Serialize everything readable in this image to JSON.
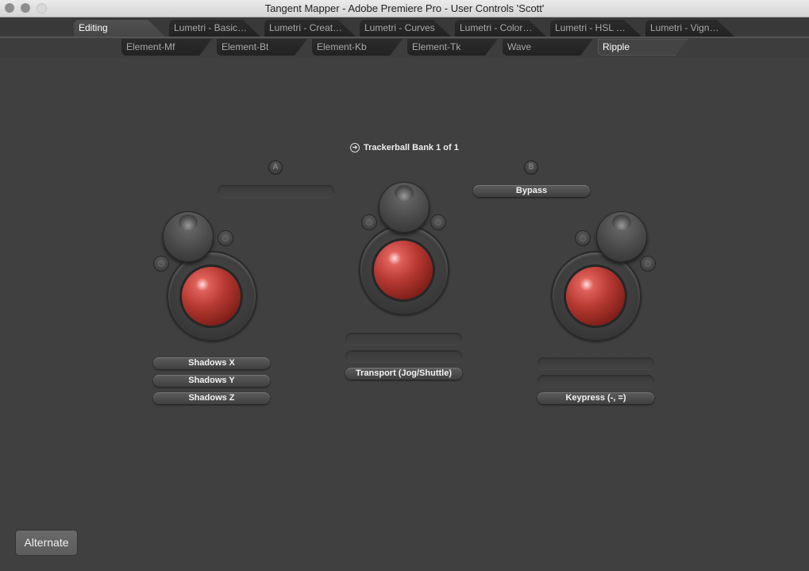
{
  "window": {
    "title": "Tangent Mapper - Adobe Premiere Pro - User Controls 'Scott'"
  },
  "tabs_primary": [
    {
      "label": "Editing",
      "active": true
    },
    {
      "label": "Lumetri - Basic…",
      "active": false
    },
    {
      "label": "Lumetri - Creat…",
      "active": false
    },
    {
      "label": "Lumetri - Curves",
      "active": false
    },
    {
      "label": "Lumetri - Color…",
      "active": false
    },
    {
      "label": "Lumetri - HSL …",
      "active": false
    },
    {
      "label": "Lumetri - Vign…",
      "active": false
    }
  ],
  "tabs_secondary": [
    {
      "label": "Element-Mf",
      "active": false
    },
    {
      "label": "Element-Bt",
      "active": false
    },
    {
      "label": "Element-Kb",
      "active": false
    },
    {
      "label": "Element-Tk",
      "active": false
    },
    {
      "label": "Wave",
      "active": false
    },
    {
      "label": "Ripple",
      "active": true
    }
  ],
  "bank": {
    "icon": "arrow-right-circle-icon",
    "label": "Trackerball Bank 1 of 1"
  },
  "buttons_ab": {
    "a_label": "A",
    "a_assignment": "",
    "b_label": "B",
    "b_assignment": "Bypass"
  },
  "trackballs": {
    "left": {
      "assignments": [
        "Shadows X",
        "Shadows Y",
        "Shadows Z"
      ]
    },
    "center": {
      "assignments": [
        "",
        "",
        "Transport (Jog/Shuttle)"
      ]
    },
    "right": {
      "assignments": [
        "",
        "",
        "Keypress (-, =)"
      ]
    }
  },
  "footer": {
    "alternate_label": "Alternate"
  },
  "colors": {
    "background": "#404040",
    "trackball_red": "#b73a33"
  }
}
